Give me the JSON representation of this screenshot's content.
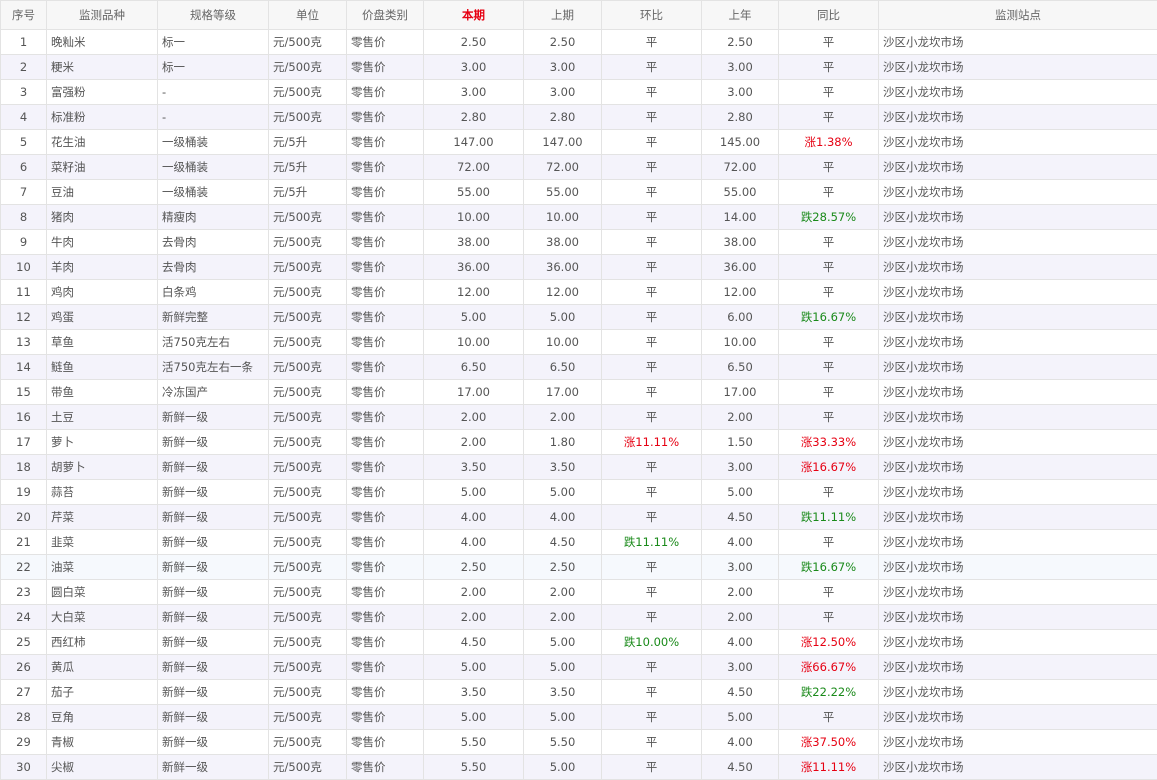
{
  "colors": {
    "rise": "#e60012",
    "fall": "#1a8a1a",
    "current_header": "#e60012"
  },
  "table": {
    "headers": [
      "序号",
      "监测品种",
      "规格等级",
      "单位",
      "价盘类别",
      "本期",
      "上期",
      "环比",
      "上年",
      "同比",
      "监测站点"
    ],
    "rows": [
      [
        "1",
        "晚籼米",
        "标一",
        "元/500克",
        "零售价",
        "2.50",
        "2.50",
        "平",
        "2.50",
        "平",
        "沙区小龙坎市场"
      ],
      [
        "2",
        "粳米",
        "标一",
        "元/500克",
        "零售价",
        "3.00",
        "3.00",
        "平",
        "3.00",
        "平",
        "沙区小龙坎市场"
      ],
      [
        "3",
        "富强粉",
        "-",
        "元/500克",
        "零售价",
        "3.00",
        "3.00",
        "平",
        "3.00",
        "平",
        "沙区小龙坎市场"
      ],
      [
        "4",
        "标准粉",
        "-",
        "元/500克",
        "零售价",
        "2.80",
        "2.80",
        "平",
        "2.80",
        "平",
        "沙区小龙坎市场"
      ],
      [
        "5",
        "花生油",
        "一级桶装",
        "元/5升",
        "零售价",
        "147.00",
        "147.00",
        "平",
        "145.00",
        "涨1.38%",
        "沙区小龙坎市场"
      ],
      [
        "6",
        "菜籽油",
        "一级桶装",
        "元/5升",
        "零售价",
        "72.00",
        "72.00",
        "平",
        "72.00",
        "平",
        "沙区小龙坎市场"
      ],
      [
        "7",
        "豆油",
        "一级桶装",
        "元/5升",
        "零售价",
        "55.00",
        "55.00",
        "平",
        "55.00",
        "平",
        "沙区小龙坎市场"
      ],
      [
        "8",
        "猪肉",
        "精瘦肉",
        "元/500克",
        "零售价",
        "10.00",
        "10.00",
        "平",
        "14.00",
        "跌28.57%",
        "沙区小龙坎市场"
      ],
      [
        "9",
        "牛肉",
        "去骨肉",
        "元/500克",
        "零售价",
        "38.00",
        "38.00",
        "平",
        "38.00",
        "平",
        "沙区小龙坎市场"
      ],
      [
        "10",
        "羊肉",
        "去骨肉",
        "元/500克",
        "零售价",
        "36.00",
        "36.00",
        "平",
        "36.00",
        "平",
        "沙区小龙坎市场"
      ],
      [
        "11",
        "鸡肉",
        "白条鸡",
        "元/500克",
        "零售价",
        "12.00",
        "12.00",
        "平",
        "12.00",
        "平",
        "沙区小龙坎市场"
      ],
      [
        "12",
        "鸡蛋",
        "新鲜完整",
        "元/500克",
        "零售价",
        "5.00",
        "5.00",
        "平",
        "6.00",
        "跌16.67%",
        "沙区小龙坎市场"
      ],
      [
        "13",
        "草鱼",
        "活750克左右",
        "元/500克",
        "零售价",
        "10.00",
        "10.00",
        "平",
        "10.00",
        "平",
        "沙区小龙坎市场"
      ],
      [
        "14",
        "鲢鱼",
        "活750克左右一条",
        "元/500克",
        "零售价",
        "6.50",
        "6.50",
        "平",
        "6.50",
        "平",
        "沙区小龙坎市场"
      ],
      [
        "15",
        "带鱼",
        "冷冻国产",
        "元/500克",
        "零售价",
        "17.00",
        "17.00",
        "平",
        "17.00",
        "平",
        "沙区小龙坎市场"
      ],
      [
        "16",
        "土豆",
        "新鲜一级",
        "元/500克",
        "零售价",
        "2.00",
        "2.00",
        "平",
        "2.00",
        "平",
        "沙区小龙坎市场"
      ],
      [
        "17",
        "萝卜",
        "新鲜一级",
        "元/500克",
        "零售价",
        "2.00",
        "1.80",
        "涨11.11%",
        "1.50",
        "涨33.33%",
        "沙区小龙坎市场"
      ],
      [
        "18",
        "胡萝卜",
        "新鲜一级",
        "元/500克",
        "零售价",
        "3.50",
        "3.50",
        "平",
        "3.00",
        "涨16.67%",
        "沙区小龙坎市场"
      ],
      [
        "19",
        "蒜苔",
        "新鲜一级",
        "元/500克",
        "零售价",
        "5.00",
        "5.00",
        "平",
        "5.00",
        "平",
        "沙区小龙坎市场"
      ],
      [
        "20",
        "芹菜",
        "新鲜一级",
        "元/500克",
        "零售价",
        "4.00",
        "4.00",
        "平",
        "4.50",
        "跌11.11%",
        "沙区小龙坎市场"
      ],
      [
        "21",
        "韭菜",
        "新鲜一级",
        "元/500克",
        "零售价",
        "4.00",
        "4.50",
        "跌11.11%",
        "4.00",
        "平",
        "沙区小龙坎市场"
      ],
      [
        "22",
        "油菜",
        "新鲜一级",
        "元/500克",
        "零售价",
        "2.50",
        "2.50",
        "平",
        "3.00",
        "跌16.67%",
        "沙区小龙坎市场"
      ],
      [
        "23",
        "圆白菜",
        "新鲜一级",
        "元/500克",
        "零售价",
        "2.00",
        "2.00",
        "平",
        "2.00",
        "平",
        "沙区小龙坎市场"
      ],
      [
        "24",
        "大白菜",
        "新鲜一级",
        "元/500克",
        "零售价",
        "2.00",
        "2.00",
        "平",
        "2.00",
        "平",
        "沙区小龙坎市场"
      ],
      [
        "25",
        "西红柿",
        "新鲜一级",
        "元/500克",
        "零售价",
        "4.50",
        "5.00",
        "跌10.00%",
        "4.00",
        "涨12.50%",
        "沙区小龙坎市场"
      ],
      [
        "26",
        "黄瓜",
        "新鲜一级",
        "元/500克",
        "零售价",
        "5.00",
        "5.00",
        "平",
        "3.00",
        "涨66.67%",
        "沙区小龙坎市场"
      ],
      [
        "27",
        "茄子",
        "新鲜一级",
        "元/500克",
        "零售价",
        "3.50",
        "3.50",
        "平",
        "4.50",
        "跌22.22%",
        "沙区小龙坎市场"
      ],
      [
        "28",
        "豆角",
        "新鲜一级",
        "元/500克",
        "零售价",
        "5.00",
        "5.00",
        "平",
        "5.00",
        "平",
        "沙区小龙坎市场"
      ],
      [
        "29",
        "青椒",
        "新鲜一级",
        "元/500克",
        "零售价",
        "5.50",
        "5.50",
        "平",
        "4.00",
        "涨37.50%",
        "沙区小龙坎市场"
      ],
      [
        "30",
        "尖椒",
        "新鲜一级",
        "元/500克",
        "零售价",
        "5.50",
        "5.00",
        "平",
        "4.50",
        "涨11.11%",
        "沙区小龙坎市场"
      ]
    ]
  }
}
